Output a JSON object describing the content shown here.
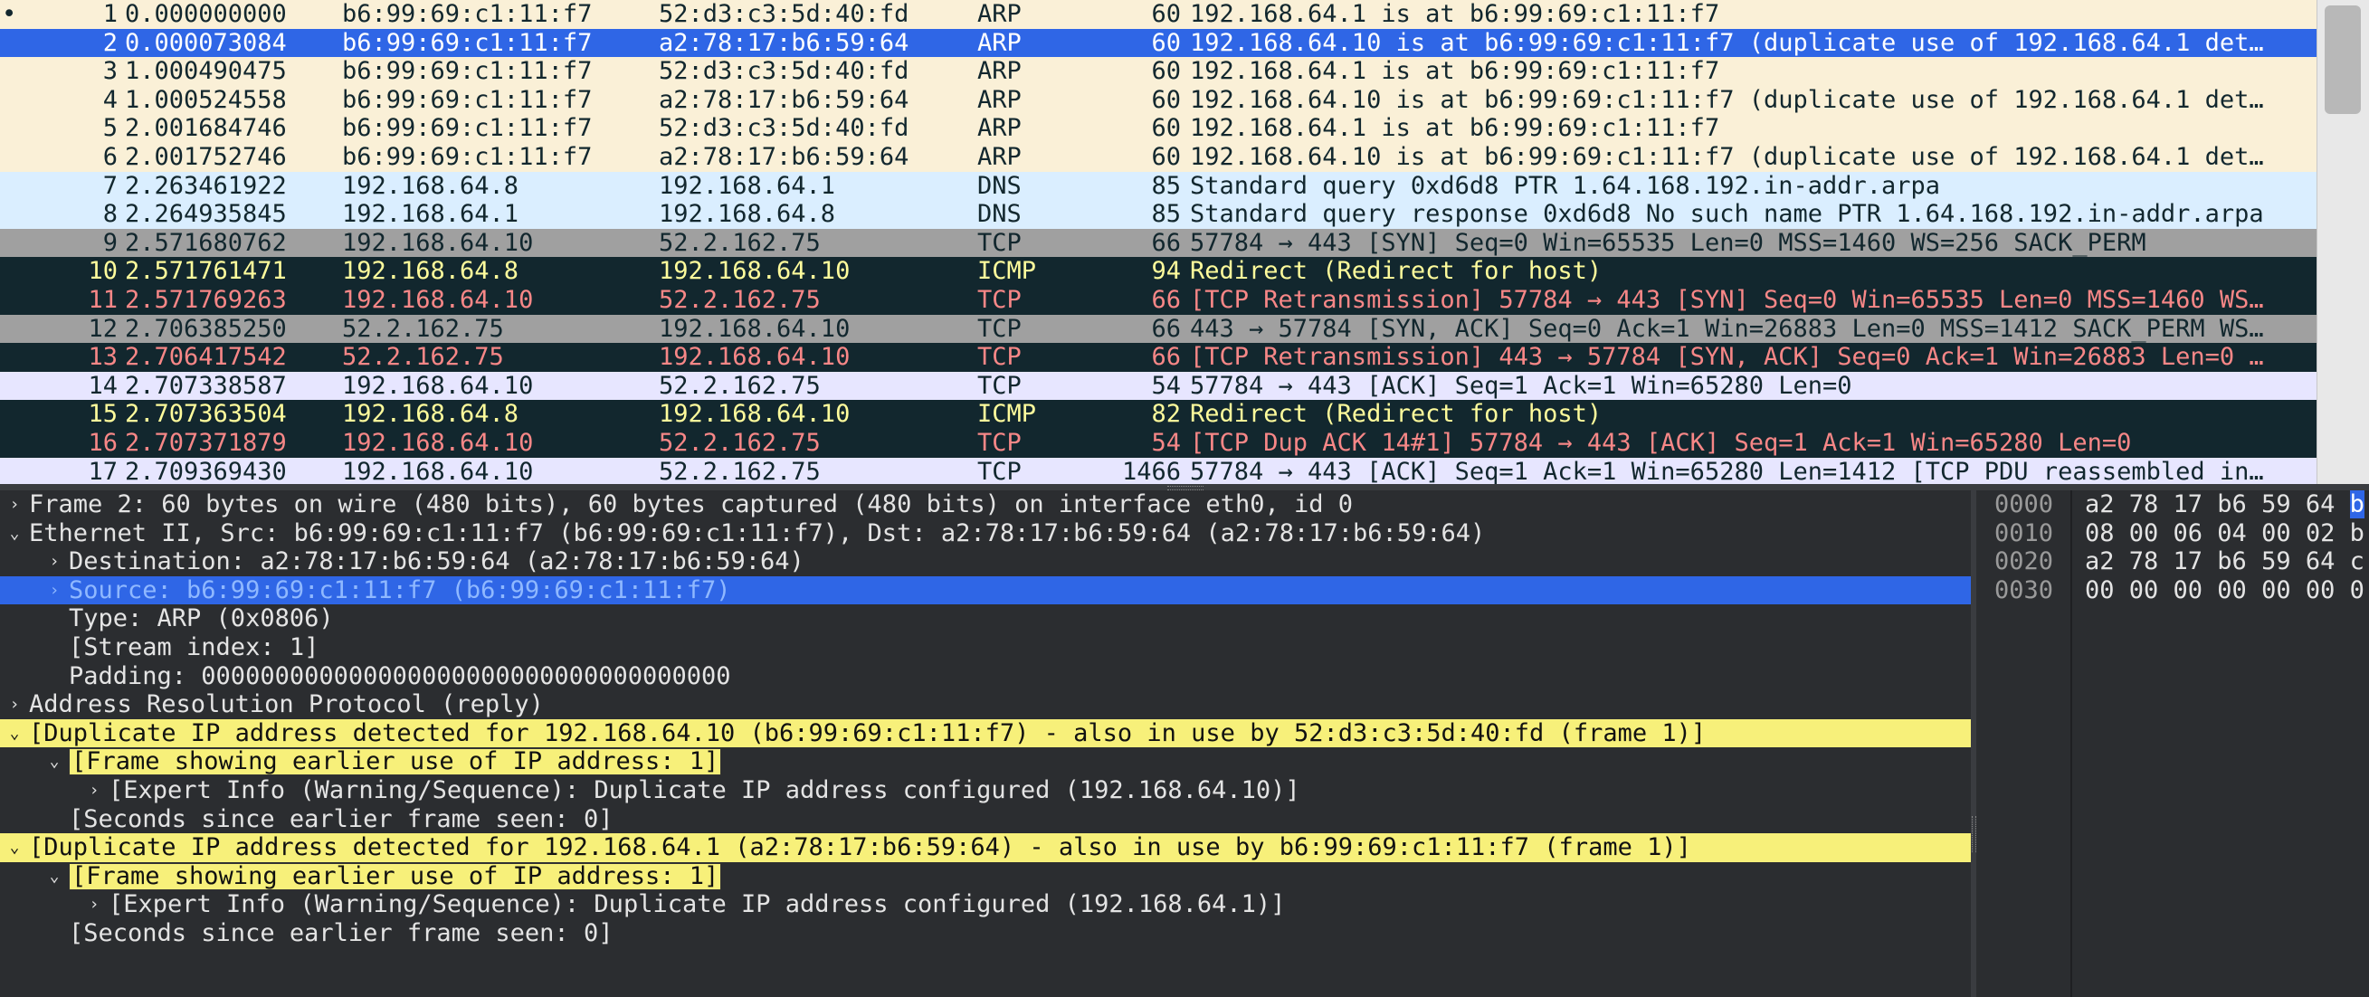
{
  "packets": [
    {
      "mark": "•",
      "no": "1",
      "time": "0.000000000",
      "src": "b6:99:69:c1:11:f7",
      "dst": "52:d3:c3:5d:40:fd",
      "proto": "ARP",
      "len": "60",
      "info": "192.168.64.1 is at b6:99:69:c1:11:f7",
      "style": "arp"
    },
    {
      "mark": "",
      "no": "2",
      "time": "0.000073084",
      "src": "b6:99:69:c1:11:f7",
      "dst": "a2:78:17:b6:59:64",
      "proto": "ARP",
      "len": "60",
      "info": "192.168.64.10 is at b6:99:69:c1:11:f7 (duplicate use of 192.168.64.1 det…",
      "style": "sel"
    },
    {
      "mark": "",
      "no": "3",
      "time": "1.000490475",
      "src": "b6:99:69:c1:11:f7",
      "dst": "52:d3:c3:5d:40:fd",
      "proto": "ARP",
      "len": "60",
      "info": "192.168.64.1 is at b6:99:69:c1:11:f7",
      "style": "arp"
    },
    {
      "mark": "",
      "no": "4",
      "time": "1.000524558",
      "src": "b6:99:69:c1:11:f7",
      "dst": "a2:78:17:b6:59:64",
      "proto": "ARP",
      "len": "60",
      "info": "192.168.64.10 is at b6:99:69:c1:11:f7 (duplicate use of 192.168.64.1 det…",
      "style": "arp"
    },
    {
      "mark": "",
      "no": "5",
      "time": "2.001684746",
      "src": "b6:99:69:c1:11:f7",
      "dst": "52:d3:c3:5d:40:fd",
      "proto": "ARP",
      "len": "60",
      "info": "192.168.64.1 is at b6:99:69:c1:11:f7",
      "style": "arp"
    },
    {
      "mark": "",
      "no": "6",
      "time": "2.001752746",
      "src": "b6:99:69:c1:11:f7",
      "dst": "a2:78:17:b6:59:64",
      "proto": "ARP",
      "len": "60",
      "info": "192.168.64.10 is at b6:99:69:c1:11:f7 (duplicate use of 192.168.64.1 det…",
      "style": "arp"
    },
    {
      "mark": "",
      "no": "7",
      "time": "2.263461922",
      "src": "192.168.64.8",
      "dst": "192.168.64.1",
      "proto": "DNS",
      "len": "85",
      "info": "Standard query 0xd6d8 PTR 1.64.168.192.in-addr.arpa",
      "style": "dns"
    },
    {
      "mark": "",
      "no": "8",
      "time": "2.264935845",
      "src": "192.168.64.1",
      "dst": "192.168.64.8",
      "proto": "DNS",
      "len": "85",
      "info": "Standard query response 0xd6d8 No such name PTR 1.64.168.192.in-addr.arpa",
      "style": "dns"
    },
    {
      "mark": "",
      "no": "9",
      "time": "2.571680762",
      "src": "192.168.64.10",
      "dst": "52.2.162.75",
      "proto": "TCP",
      "len": "66",
      "info": "57784 → 443 [SYN] Seq=0 Win=65535 Len=0 MSS=1460 WS=256 SACK_PERM",
      "style": "syn"
    },
    {
      "mark": "",
      "no": "10",
      "time": "2.571761471",
      "src": "192.168.64.8",
      "dst": "192.168.64.10",
      "proto": "ICMP",
      "len": "94",
      "info": "Redirect             (Redirect for host)",
      "style": "icmp"
    },
    {
      "mark": "",
      "no": "11",
      "time": "2.571769263",
      "src": "192.168.64.10",
      "dst": "52.2.162.75",
      "proto": "TCP",
      "len": "66",
      "info": "[TCP Retransmission] 57784 → 443 [SYN] Seq=0 Win=65535 Len=0 MSS=1460 WS…",
      "style": "bad"
    },
    {
      "mark": "",
      "no": "12",
      "time": "2.706385250",
      "src": "52.2.162.75",
      "dst": "192.168.64.10",
      "proto": "TCP",
      "len": "66",
      "info": "443 → 57784 [SYN, ACK] Seq=0 Ack=1 Win=26883 Len=0 MSS=1412 SACK_PERM WS…",
      "style": "syn"
    },
    {
      "mark": "",
      "no": "13",
      "time": "2.706417542",
      "src": "52.2.162.75",
      "dst": "192.168.64.10",
      "proto": "TCP",
      "len": "66",
      "info": "[TCP Retransmission] 443 → 57784 [SYN, ACK] Seq=0 Ack=1 Win=26883 Len=0 …",
      "style": "bad"
    },
    {
      "mark": "",
      "no": "14",
      "time": "2.707338587",
      "src": "192.168.64.10",
      "dst": "52.2.162.75",
      "proto": "TCP",
      "len": "54",
      "info": "57784 → 443 [ACK] Seq=1 Ack=1 Win=65280 Len=0",
      "style": "tcp"
    },
    {
      "mark": "",
      "no": "15",
      "time": "2.707363504",
      "src": "192.168.64.8",
      "dst": "192.168.64.10",
      "proto": "ICMP",
      "len": "82",
      "info": "Redirect             (Redirect for host)",
      "style": "icmp"
    },
    {
      "mark": "",
      "no": "16",
      "time": "2.707371879",
      "src": "192.168.64.10",
      "dst": "52.2.162.75",
      "proto": "TCP",
      "len": "54",
      "info": "[TCP Dup ACK 14#1] 57784 → 443 [ACK] Seq=1 Ack=1 Win=65280 Len=0",
      "style": "bad"
    },
    {
      "mark": "",
      "no": "17",
      "time": "2.709369430",
      "src": "192.168.64.10",
      "dst": "52.2.162.75",
      "proto": "TCP",
      "len": "1466",
      "info": "57784 → 443 [ACK] Seq=1 Ack=1 Win=65280 Len=1412 [TCP PDU reassembled in…",
      "style": "tcp"
    }
  ],
  "details": [
    {
      "indent": 0,
      "tw": "›",
      "text": "Frame 2: 60 bytes on wire (480 bits), 60 bytes captured (480 bits) on interface eth0, id 0",
      "style": ""
    },
    {
      "indent": 0,
      "tw": "⌄",
      "text": "Ethernet II, Src: b6:99:69:c1:11:f7 (b6:99:69:c1:11:f7), Dst: a2:78:17:b6:59:64 (a2:78:17:b6:59:64)",
      "style": ""
    },
    {
      "indent": 1,
      "tw": "›",
      "text": "Destination: a2:78:17:b6:59:64 (a2:78:17:b6:59:64)",
      "style": ""
    },
    {
      "indent": 1,
      "tw": "›",
      "text": "Source: b6:99:69:c1:11:f7 (b6:99:69:c1:11:f7)",
      "style": "sel"
    },
    {
      "indent": 1,
      "tw": "",
      "text": "Type: ARP (0x0806)",
      "style": ""
    },
    {
      "indent": 1,
      "tw": "",
      "text": "[Stream index: 1]",
      "style": ""
    },
    {
      "indent": 1,
      "tw": "",
      "text": "Padding: 000000000000000000000000000000000000",
      "style": ""
    },
    {
      "indent": 0,
      "tw": "›",
      "text": "Address Resolution Protocol (reply)",
      "style": ""
    },
    {
      "indent": 0,
      "tw": "⌄",
      "text": "[Duplicate IP address detected for 192.168.64.10 (b6:99:69:c1:11:f7) - also in use by 52:d3:c3:5d:40:fd (frame 1)]",
      "style": "warnfull"
    },
    {
      "indent": 1,
      "tw": "⌄",
      "text": "[Frame showing earlier use of IP address: 1]",
      "style": "warnbox"
    },
    {
      "indent": 2,
      "tw": "›",
      "text": "[Expert Info (Warning/Sequence): Duplicate IP address configured (192.168.64.10)]",
      "style": ""
    },
    {
      "indent": 1,
      "tw": "",
      "text": "[Seconds since earlier frame seen: 0]",
      "style": ""
    },
    {
      "indent": 0,
      "tw": "⌄",
      "text": "[Duplicate IP address detected for 192.168.64.1 (a2:78:17:b6:59:64) - also in use by b6:99:69:c1:11:f7 (frame 1)]",
      "style": "warnfull"
    },
    {
      "indent": 1,
      "tw": "⌄",
      "text": "[Frame showing earlier use of IP address: 1]",
      "style": "warnbox"
    },
    {
      "indent": 2,
      "tw": "›",
      "text": "[Expert Info (Warning/Sequence): Duplicate IP address configured (192.168.64.1)]",
      "style": ""
    },
    {
      "indent": 1,
      "tw": "",
      "text": "[Seconds since earlier frame seen: 0]",
      "style": ""
    }
  ],
  "bytes": [
    {
      "offset": "0000",
      "hex": "a2 78 17 b6 59 64 ",
      "hl": "b"
    },
    {
      "offset": "0010",
      "hex": "08 00 06 04 00 02 b",
      "hl": ""
    },
    {
      "offset": "0020",
      "hex": "a2 78 17 b6 59 64 c",
      "hl": ""
    },
    {
      "offset": "0030",
      "hex": "00 00 00 00 00 00 0",
      "hl": ""
    }
  ],
  "colors": {
    "arp": "#faf0d7",
    "dns": "#daeeff",
    "tcp": "#e7e6ff",
    "syn": "#a0a0a0",
    "bad_bg": "#12272e",
    "bad_fg": "#f78787",
    "icmp_fg": "#fffc9c",
    "selected": "#2f66e6",
    "warning": "#f7f07a",
    "pane_bg": "#2b2d30"
  }
}
